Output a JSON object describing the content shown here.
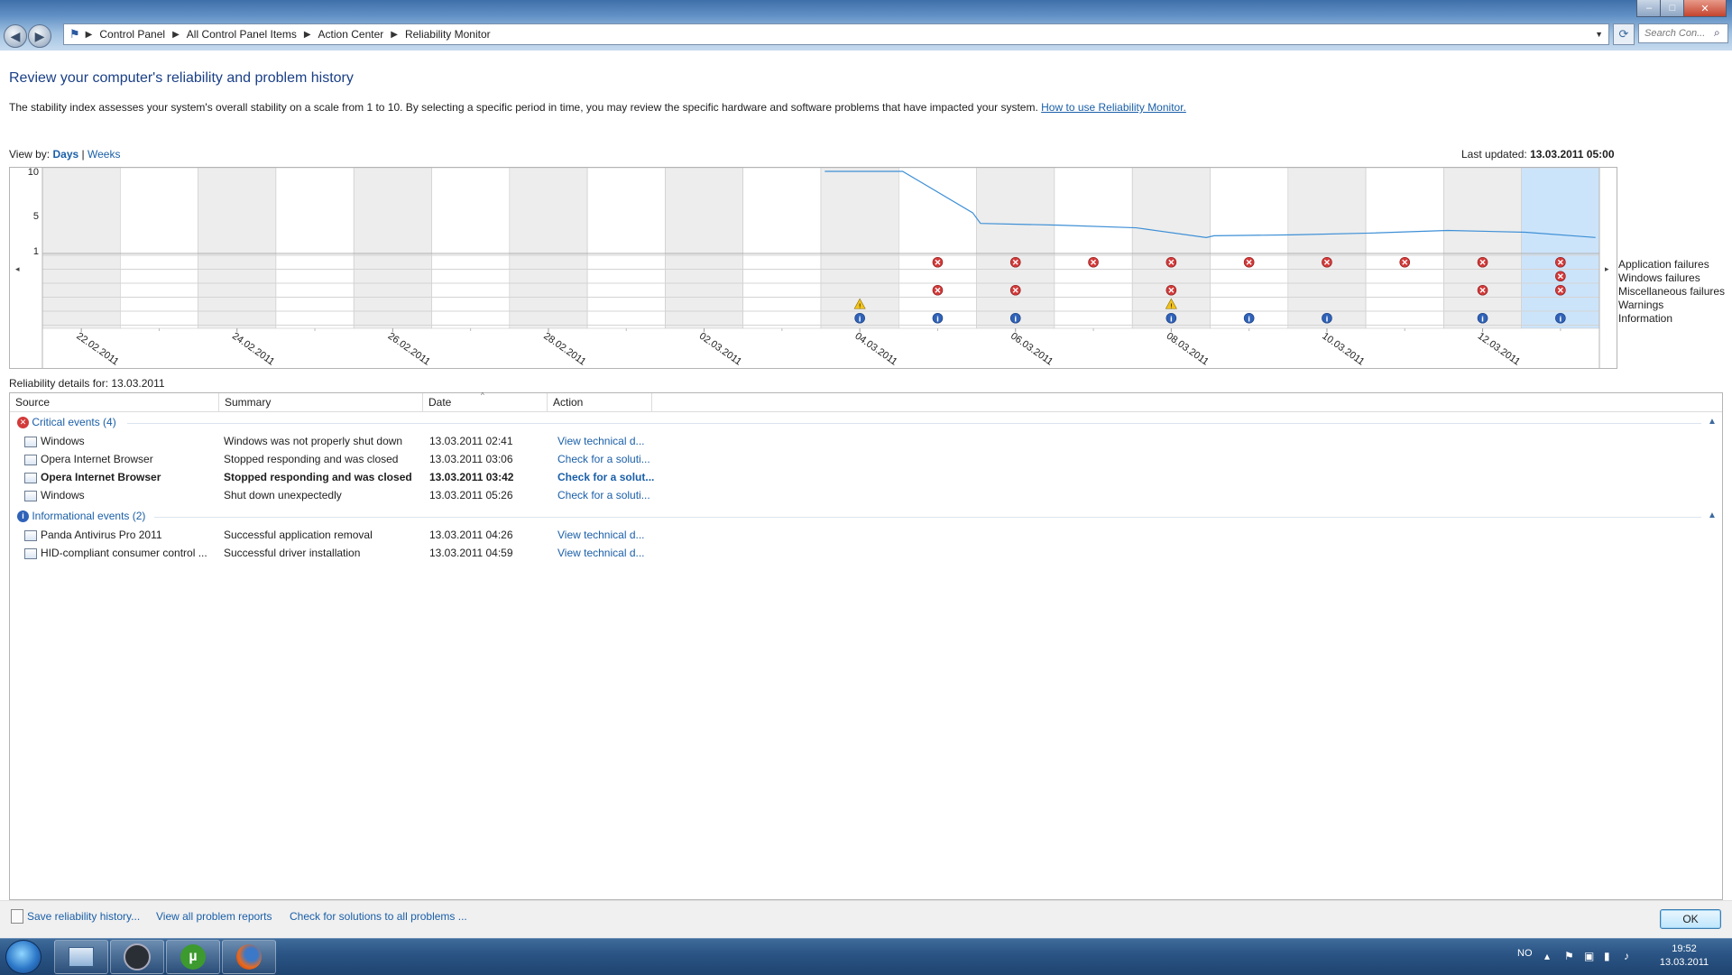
{
  "breadcrumb": [
    "Control Panel",
    "All Control Panel Items",
    "Action Center",
    "Reliability Monitor"
  ],
  "search": {
    "placeholder": "Search Con..."
  },
  "page": {
    "title": "Review your computer's reliability and problem history",
    "intro": "The stability index assesses your system's overall stability on a scale from 1 to 10. By selecting a specific period in time, you may review the specific hardware and software problems that have impacted your system.",
    "help_link": "How to use Reliability Monitor."
  },
  "view_by": {
    "label": "View by:",
    "days": "Days",
    "separator": "|",
    "weeks": "Weeks"
  },
  "last_updated": {
    "label": "Last updated:",
    "value": "13.03.2011 05:00"
  },
  "chart_data": {
    "type": "line",
    "title": "",
    "ylim": [
      1,
      10
    ],
    "yticks": [
      "10",
      "5",
      "1"
    ],
    "columns": [
      "22.02.2011",
      "23.02.2011",
      "24.02.2011",
      "25.02.2011",
      "26.02.2011",
      "27.02.2011",
      "28.02.2011",
      "01.03.2011",
      "02.03.2011",
      "03.03.2011",
      "04.03.2011",
      "05.03.2011",
      "06.03.2011",
      "07.03.2011",
      "08.03.2011",
      "09.03.2011",
      "10.03.2011",
      "11.03.2011",
      "12.03.2011",
      "13.03.2011"
    ],
    "date_labels": [
      "22.02.2011",
      "24.02.2011",
      "26.02.2011",
      "28.02.2011",
      "02.03.2011",
      "04.03.2011",
      "06.03.2011",
      "08.03.2011",
      "10.03.2011",
      "12.03.2011"
    ],
    "selected_column": "13.03.2011",
    "stability_index": [
      {
        "x": "04.03.2011",
        "y": 10.0
      },
      {
        "x": "05.03.2011",
        "y": 10.0
      },
      {
        "x": "05.03.2011",
        "y": 5.3
      },
      {
        "x": "06.03.2011",
        "y": 4.1
      },
      {
        "x": "07.03.2011",
        "y": 3.9
      },
      {
        "x": "08.03.2011",
        "y": 3.6
      },
      {
        "x": "08.03.2011",
        "y": 2.5
      },
      {
        "x": "09.03.2011",
        "y": 2.7
      },
      {
        "x": "10.03.2011",
        "y": 2.8
      },
      {
        "x": "11.03.2011",
        "y": 3.0
      },
      {
        "x": "12.03.2011",
        "y": 3.3
      },
      {
        "x": "13.03.2011",
        "y": 3.1
      },
      {
        "x": "13.03.2011",
        "y": 2.5
      }
    ],
    "categories": [
      "Application failures",
      "Windows failures",
      "Miscellaneous failures",
      "Warnings",
      "Information"
    ],
    "event_markers": {
      "Application failures": [
        "05.03.2011",
        "06.03.2011",
        "07.03.2011",
        "08.03.2011",
        "09.03.2011",
        "10.03.2011",
        "11.03.2011",
        "12.03.2011",
        "13.03.2011"
      ],
      "Windows failures": [
        "13.03.2011"
      ],
      "Miscellaneous failures": [
        "05.03.2011",
        "06.03.2011",
        "08.03.2011",
        "12.03.2011",
        "13.03.2011"
      ],
      "Warnings": [
        "04.03.2011",
        "08.03.2011"
      ],
      "Information": [
        "04.03.2011",
        "05.03.2011",
        "06.03.2011",
        "08.03.2011",
        "09.03.2011",
        "10.03.2011",
        "12.03.2011",
        "13.03.2011"
      ]
    },
    "colors": {
      "line": "#3d8fd6",
      "selected": "#cce4fa",
      "weekend": "#ededed",
      "error": "#d33a3a",
      "warning": "#f2c31c",
      "info": "#2f62b8"
    }
  },
  "details": {
    "label": "Reliability details for: 13.03.2011",
    "columns": [
      "Source",
      "Summary",
      "Date",
      "Action"
    ],
    "groups": [
      {
        "title": "Critical events (4)",
        "icon": "error-icon",
        "rows": [
          {
            "source": "Windows",
            "summary": "Windows was not properly shut down",
            "date": "13.03.2011 02:41",
            "action": "View  technical d...",
            "bold": false
          },
          {
            "source": "Opera Internet Browser",
            "summary": "Stopped responding and was closed",
            "date": "13.03.2011 03:06",
            "action": "Check for a soluti...",
            "bold": false
          },
          {
            "source": "Opera Internet Browser",
            "summary": "Stopped responding and was closed",
            "date": "13.03.2011 03:42",
            "action": "Check for a solut...",
            "bold": true
          },
          {
            "source": "Windows",
            "summary": "Shut down unexpectedly",
            "date": "13.03.2011 05:26",
            "action": "Check for a soluti...",
            "bold": false
          }
        ]
      },
      {
        "title": "Informational events (2)",
        "icon": "info-icon",
        "rows": [
          {
            "source": "Panda Antivirus Pro 2011",
            "summary": "Successful application removal",
            "date": "13.03.2011 04:26",
            "action": "View  technical d...",
            "bold": false
          },
          {
            "source": "HID-compliant consumer control ...",
            "summary": "Successful driver installation",
            "date": "13.03.2011 04:59",
            "action": "View  technical d...",
            "bold": false
          }
        ]
      }
    ]
  },
  "footer": {
    "save_history": "Save reliability history...",
    "view_reports": "View all problem reports",
    "check_solutions": "Check for solutions to all problems ...",
    "ok": "OK"
  },
  "tray": {
    "language": "NO",
    "time": "19:52",
    "date": "13.03.2011"
  }
}
